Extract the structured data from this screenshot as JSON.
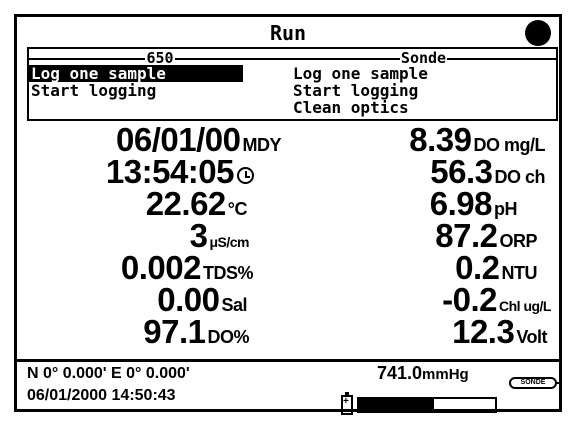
{
  "screen": {
    "title": "Run"
  },
  "menu": {
    "left": {
      "header": "650",
      "items": [
        "Log one sample",
        "Start logging"
      ],
      "selected_index": 0
    },
    "right": {
      "header": "Sonde",
      "items": [
        "Log one sample",
        "Start logging",
        "Clean optics"
      ]
    }
  },
  "readings": {
    "left": [
      {
        "value": "06/01/00",
        "unit": "MDY"
      },
      {
        "value": "13:54:05",
        "unit": "",
        "icon": "clock-icon"
      },
      {
        "value": "22.62",
        "unit": "°C"
      },
      {
        "value": "3",
        "unit": "μS/cm"
      },
      {
        "value": "0.002",
        "unit": "TDS%"
      },
      {
        "value": "0.00",
        "unit": "Sal"
      },
      {
        "value": "97.1",
        "unit": "DO%"
      }
    ],
    "right": [
      {
        "value": "8.39",
        "unit": "DO mg/L"
      },
      {
        "value": "56.3",
        "unit": "DO ch"
      },
      {
        "value": "6.98",
        "unit": "pH"
      },
      {
        "value": "87.2",
        "unit": "ORP"
      },
      {
        "value": "0.2",
        "unit": "NTU"
      },
      {
        "value": "-0.2",
        "unit": "Chl ug/L"
      },
      {
        "value": "12.3",
        "unit": "Volt"
      }
    ]
  },
  "footer": {
    "gps": "N 0° 0.000' E  0° 0.000'",
    "datetime": "06/01/2000 14:50:43",
    "pressure_value": "741.0",
    "pressure_unit": "mmHg",
    "sonde_badge": "SONDE",
    "battery_level": 0.55
  }
}
